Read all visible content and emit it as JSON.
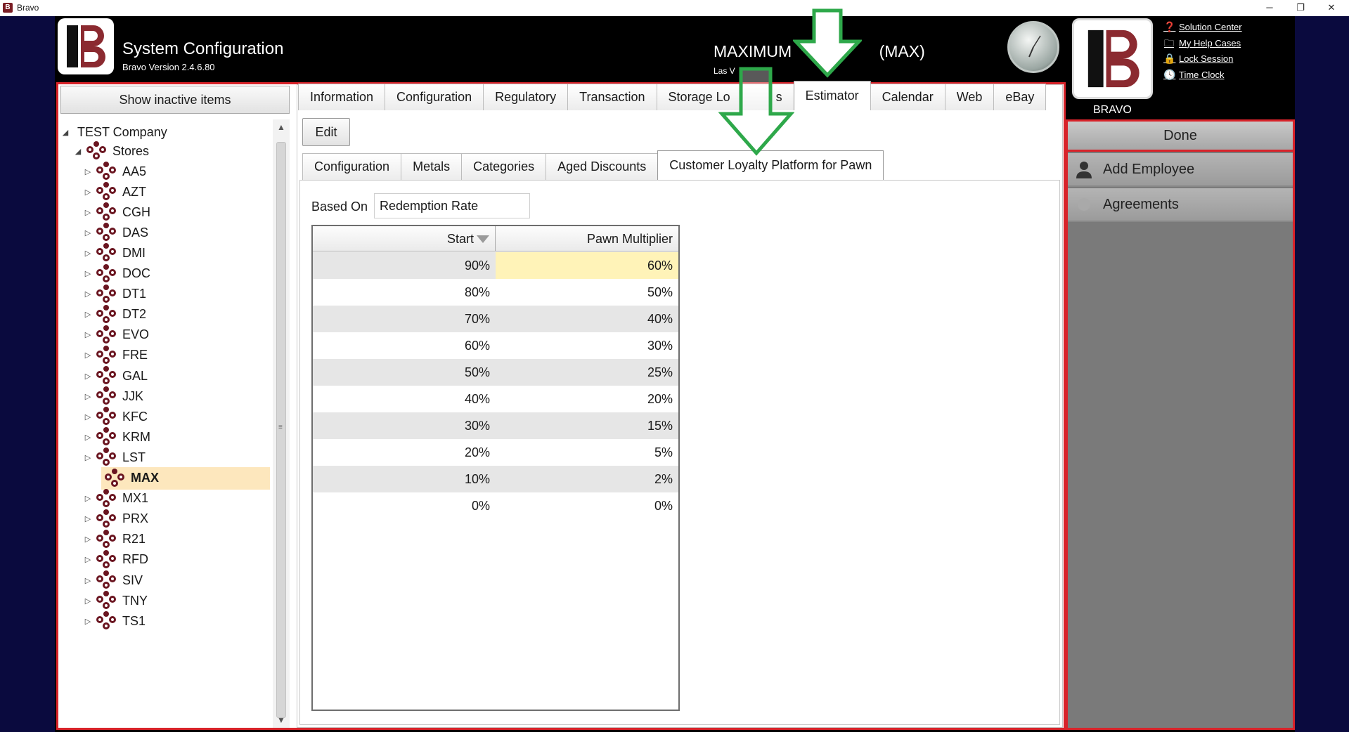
{
  "window": {
    "title": "Bravo",
    "controls": {
      "minimize": "─",
      "restore": "❐",
      "close": "✕"
    }
  },
  "header": {
    "title": "System Configuration",
    "version": "Bravo Version 2.4.6.80",
    "store_name": "MAXIMUM",
    "store_name_suffix": "(MAX)",
    "store_city": "Las V",
    "brand_label": "BRAVO",
    "quick_links": [
      {
        "label": "Solution Center",
        "icon": "help-icon"
      },
      {
        "label": "My Help Cases",
        "icon": "folder-icon"
      },
      {
        "label": "Lock Session",
        "icon": "lock-icon"
      },
      {
        "label": "Time Clock",
        "icon": "clock-icon"
      }
    ]
  },
  "left_panel": {
    "show_inactive_label": "Show inactive items",
    "tree": {
      "root": "TEST Company",
      "group": "Stores",
      "stores": [
        "AA5",
        "AZT",
        "CGH",
        "DAS",
        "DMI",
        "DOC",
        "DT1",
        "DT2",
        "EVO",
        "FRE",
        "GAL",
        "JJK",
        "KFC",
        "KRM",
        "LST",
        "MAX",
        "MX1",
        "PRX",
        "R21",
        "RFD",
        "SIV",
        "TNY",
        "TS1"
      ],
      "selected": "MAX"
    }
  },
  "main": {
    "top_tabs": [
      "Information",
      "Configuration",
      "Regulatory",
      "Transaction",
      "Storage Lo",
      "s",
      "Estimator",
      "Calendar",
      "Web",
      "eBay"
    ],
    "active_top_tab": "Estimator",
    "edit_label": "Edit",
    "sub_tabs": [
      "Configuration",
      "Metals",
      "Categories",
      "Aged Discounts",
      "Customer Loyalty Platform for Pawn"
    ],
    "active_sub_tab": "Customer Loyalty Platform for Pawn",
    "based_on_label": "Based On",
    "based_on_value": "Redemption Rate",
    "grid": {
      "columns": [
        "Start",
        "Pawn Multiplier"
      ],
      "rows": [
        [
          "90%",
          "60%"
        ],
        [
          "80%",
          "50%"
        ],
        [
          "70%",
          "40%"
        ],
        [
          "60%",
          "30%"
        ],
        [
          "50%",
          "25%"
        ],
        [
          "40%",
          "20%"
        ],
        [
          "30%",
          "15%"
        ],
        [
          "20%",
          "5%"
        ],
        [
          "10%",
          "2%"
        ],
        [
          "0%",
          "0%"
        ]
      ]
    }
  },
  "right_panel": {
    "done_label": "Done",
    "items": [
      {
        "label": "Add Employee",
        "icon": "person-icon"
      },
      {
        "label": "Agreements",
        "icon": "circle-icon"
      }
    ]
  },
  "colors": {
    "frame_red": "#d8232a",
    "arrow_green": "#2ea84a",
    "brand_red": "#7a1d24",
    "selection": "#fde7bd",
    "highlight_cell": "#fff3b8"
  }
}
